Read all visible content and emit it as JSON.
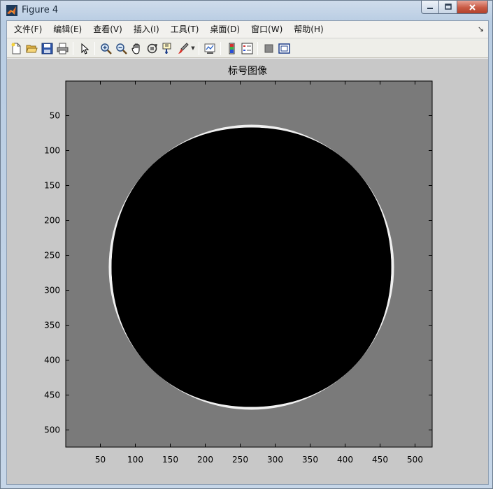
{
  "window": {
    "title": "Figure 4"
  },
  "menu": {
    "items": [
      "文件(F)",
      "编辑(E)",
      "查看(V)",
      "插入(I)",
      "工具(T)",
      "桌面(D)",
      "窗口(W)",
      "帮助(H)"
    ]
  },
  "toolbar": {
    "icons": [
      "new-figure-icon",
      "open-file-icon",
      "save-icon",
      "print-icon",
      "edit-plot-arrow-icon",
      "zoom-in-icon",
      "zoom-out-icon",
      "pan-hand-icon",
      "rotate-3d-icon",
      "data-cursor-icon",
      "brush-icon",
      "link-plot-icon",
      "insert-colorbar-icon",
      "insert-legend-icon",
      "hide-plot-tools-icon",
      "show-plot-tools-icon"
    ]
  },
  "plot": {
    "title": "标号图像",
    "x_ticks": [
      "50",
      "100",
      "150",
      "200",
      "250",
      "300",
      "350",
      "400",
      "450",
      "500"
    ],
    "y_ticks": [
      "50",
      "100",
      "150",
      "200",
      "250",
      "300",
      "350",
      "400",
      "450",
      "500"
    ],
    "x_range": [
      0.5,
      524.5
    ],
    "y_range": [
      0.5,
      524.5
    ],
    "colors": {
      "background": "#7a7a7a",
      "ring_outer": "#f0f0f0",
      "ring_dark": "#303030",
      "center": "#000000",
      "figure_bg": "#c8c8c8"
    }
  }
}
